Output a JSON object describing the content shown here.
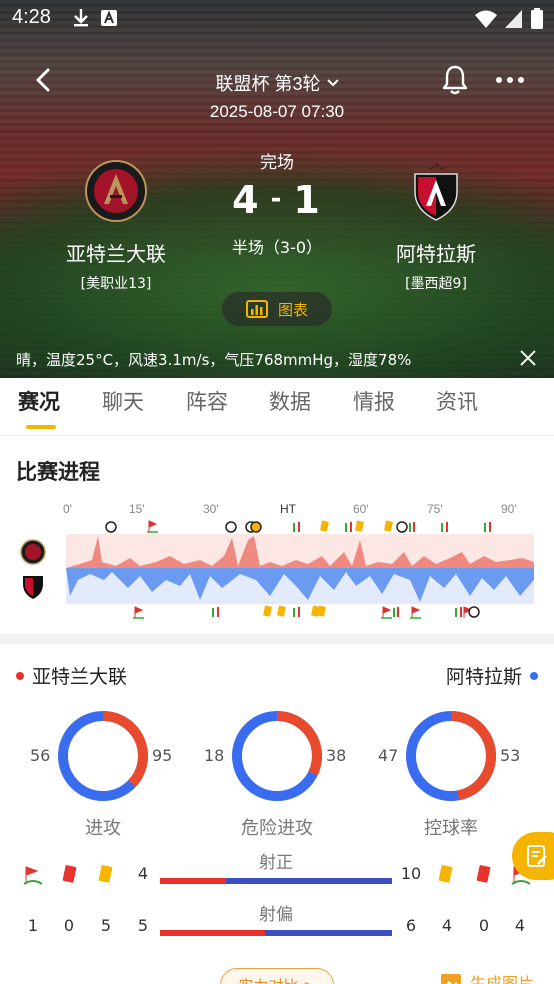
{
  "status_bar": {
    "time": "4:28"
  },
  "header": {
    "round_title": "联盟杯 第3轮",
    "match_time": "2025-08-07 07:30",
    "status": "完场",
    "score_home": "4",
    "score_away": "1",
    "score_sep": "-",
    "halftime": "半场（3-0）"
  },
  "home_team": {
    "name": "亚特兰大联",
    "rank": "[美职业13]",
    "logo_text": "ATLANTA UNITED FC",
    "color": "#a3142a"
  },
  "away_team": {
    "name": "阿特拉斯",
    "rank": "[墨西超9]",
    "color": "#c8102e"
  },
  "chart_button": {
    "label": "图表"
  },
  "weather": "晴，温度25°C，风速3.1m/s，气压768mmHg，湿度78%",
  "tabs": [
    {
      "label": "赛况",
      "active": true
    },
    {
      "label": "聊天"
    },
    {
      "label": "阵容"
    },
    {
      "label": "数据"
    },
    {
      "label": "情报"
    },
    {
      "label": "资讯"
    }
  ],
  "progress": {
    "title": "比赛进程",
    "ticks": [
      "0'",
      "15'",
      "30'",
      "HT",
      "60'",
      "75'",
      "90'"
    ],
    "home_color": "#f08a80",
    "away_color": "#6b9bf0"
  },
  "stats": {
    "home_label": "亚特兰大联",
    "away_label": "阿特拉斯",
    "home_color": "#e8322d",
    "away_color": "#3a6cf0",
    "donuts": [
      {
        "label": "进攻",
        "home": 56,
        "away": 95
      },
      {
        "label": "危险进攻",
        "home": 18,
        "away": 38
      },
      {
        "label": "控球率",
        "home": 47,
        "away": 53
      }
    ],
    "card_row": {
      "home_count": "4",
      "away_count": "10"
    },
    "bars": [
      {
        "title": "射正",
        "home": 4,
        "away": 10
      },
      {
        "title": "射偏",
        "home": 5,
        "away": 6
      }
    ],
    "off_target_row": {
      "home": [
        "1",
        "0",
        "5",
        "5"
      ],
      "away": [
        "6",
        "4",
        "0",
        "4"
      ]
    }
  },
  "bottom": {
    "compare_label": "实力对比 >",
    "generate_label": "生成图片"
  }
}
